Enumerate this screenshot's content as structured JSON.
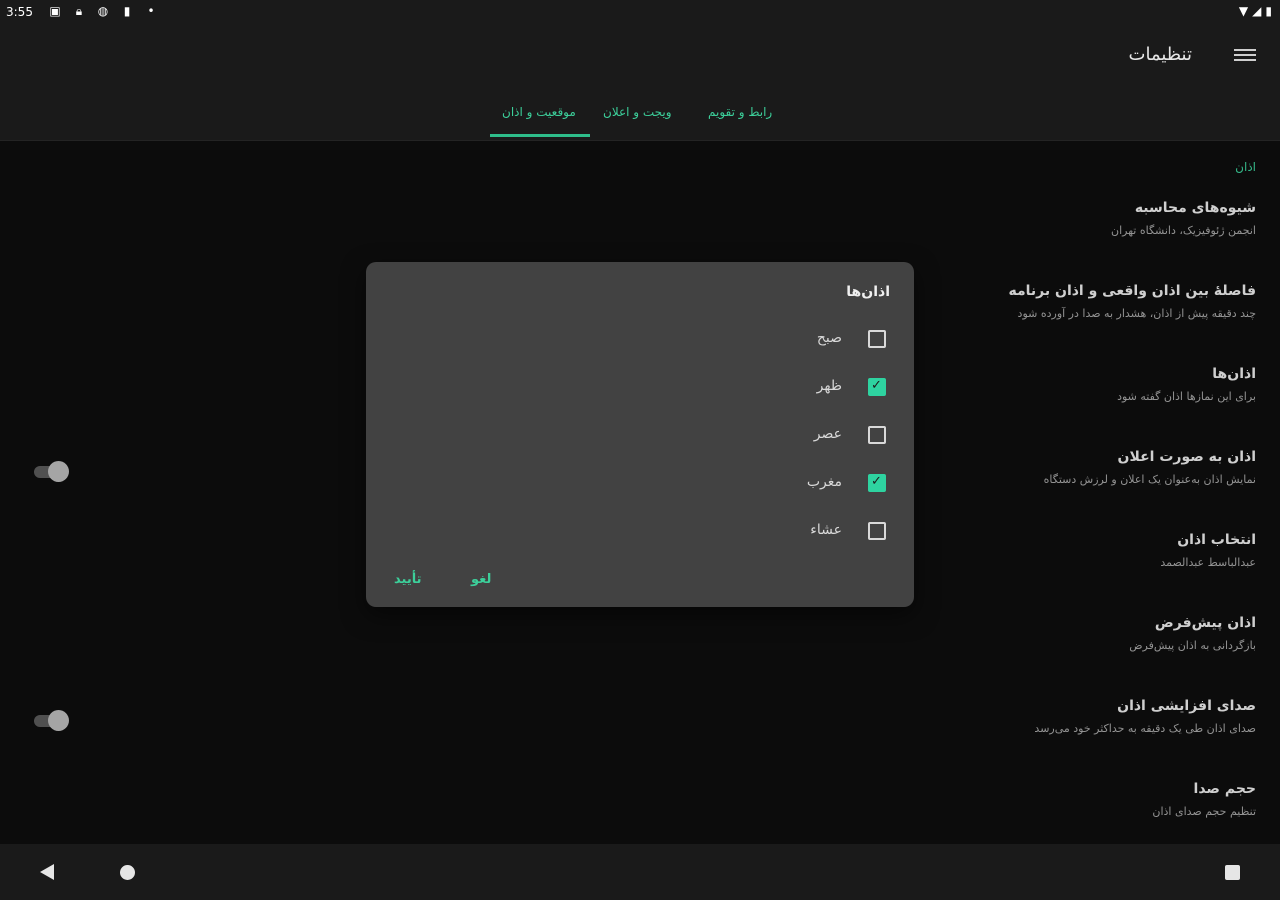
{
  "status_bar": {
    "time": "3:55",
    "icons": [
      "notification-icon",
      "lock-icon",
      "sync-icon",
      "sd-card-icon",
      "dot-icon"
    ],
    "right_icons": [
      "wifi-icon",
      "signal-icon",
      "battery-icon"
    ]
  },
  "app_bar": {
    "title": "تنظیمات"
  },
  "tabs": [
    {
      "label": "رابط و تقویم"
    },
    {
      "label": "ویجت و اعلان"
    },
    {
      "label": "موقعیت و اذان"
    }
  ],
  "section": {
    "header": "اذان"
  },
  "preferences": [
    {
      "title": "شیوه‌های محاسبه",
      "summary": "انجمن ژئوفیزیک، دانشگاه تهران"
    },
    {
      "title": "فاصلهٔ بین اذان واقعی و اذان برنامه",
      "summary": "چند دقیقه پیش از اذان، هشدار به صدا در آورده شود"
    },
    {
      "title": "اذان‌ها",
      "summary": "برای این نمازها اذان گفته شود"
    },
    {
      "title": "اذان به صورت اعلان",
      "summary": "نمایش اذان به‌عنوان یک اعلان و لرزش دستگاه"
    },
    {
      "title": "انتخاب اذان",
      "summary": "عبدالباسط عبدالصمد"
    },
    {
      "title": "اذان پیش‌فرض",
      "summary": "بازگردانی به اذان پیش‌فرض"
    },
    {
      "title": "صدای افزایشی اذان",
      "summary": "صدای اذان طی یک دقیقه به حداکثر خود می‌رسد"
    },
    {
      "title": "حجم صدا",
      "summary": "تنظیم حجم صدای اذان"
    }
  ],
  "switches": [
    {
      "pref": "اذان به صورت اعلان",
      "state": "off"
    },
    {
      "pref": "صدای افزایشی اذان",
      "state": "off"
    }
  ],
  "dialog": {
    "title": "اذان‌ها",
    "options": [
      {
        "label": "صبح",
        "checked": false
      },
      {
        "label": "ظهر",
        "checked": true
      },
      {
        "label": "عصر",
        "checked": false
      },
      {
        "label": "مغرب",
        "checked": true
      },
      {
        "label": "عشاء",
        "checked": false
      }
    ],
    "confirm_label": "تأیید",
    "cancel_label": "لغو"
  },
  "colors": {
    "accent": "#2ed3a0",
    "background": "#0e0e0e",
    "dialog": "#424242"
  }
}
